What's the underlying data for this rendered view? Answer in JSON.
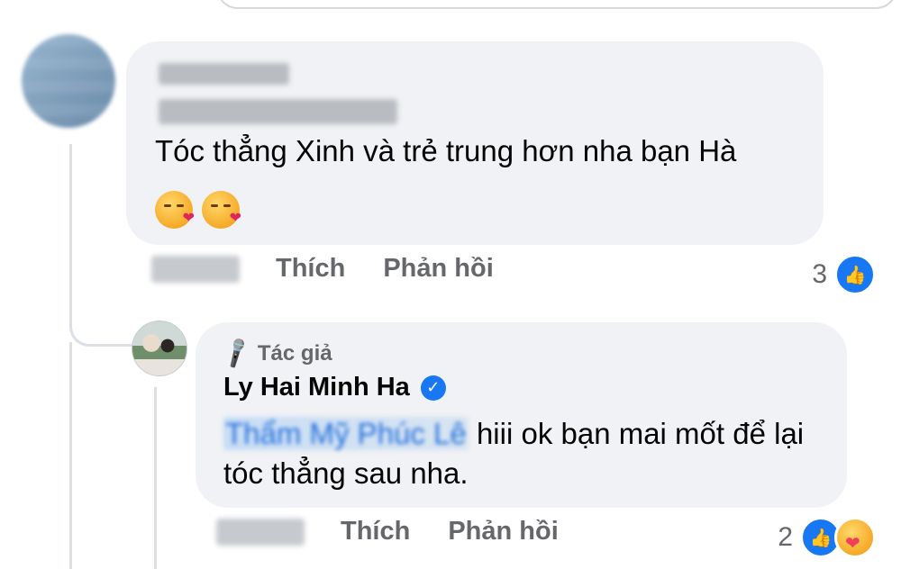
{
  "comment1": {
    "author_name": "",
    "text": "Tóc thẳng Xinh và trẻ trung hơn nha bạn Hà",
    "emojis": [
      "kissing-heart",
      "kissing-heart"
    ],
    "like_label": "Thích",
    "reply_label": "Phản hồi",
    "reaction_count": "3"
  },
  "reply1": {
    "badge": "Tác giả",
    "author_name": "Ly Hai Minh Ha",
    "mention": "Thẩm Mỹ Phúc Lê",
    "text": " hiii ok bạn mai mốt để lại tóc thẳng sau nha.",
    "like_label": "Thích",
    "reply_label": "Phản hồi",
    "reaction_count": "2"
  },
  "colors": {
    "bubble": "#f0f2f5",
    "meta": "#65676b",
    "like_blue": "#1877f2",
    "mention": "#216fdb"
  },
  "icons": {
    "like": "like-icon",
    "care": "care-icon",
    "verified": "verified-badge-icon",
    "author": "microphone-icon"
  }
}
